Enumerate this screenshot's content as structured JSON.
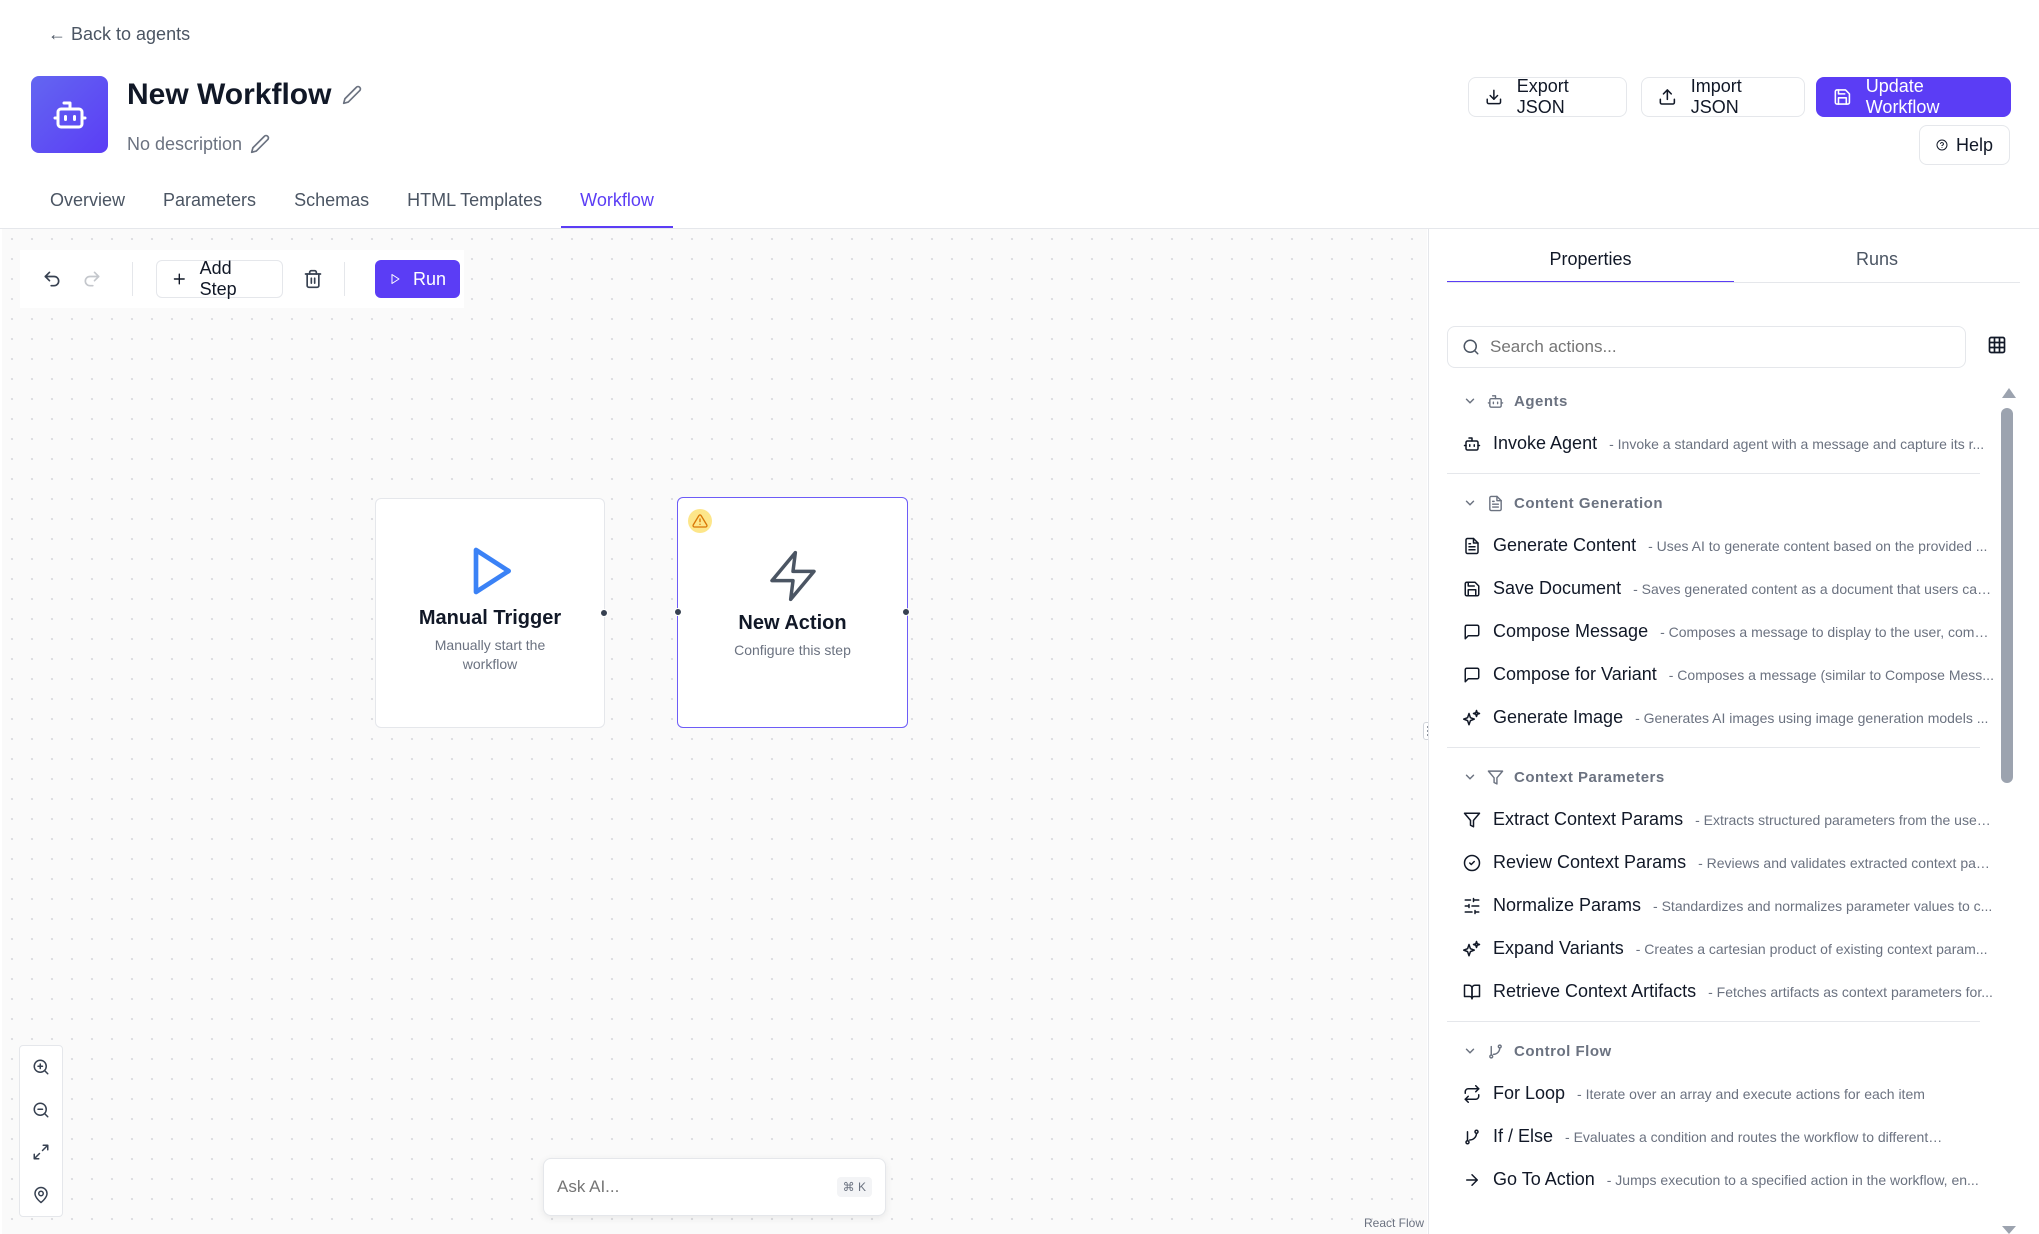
{
  "header": {
    "back_link": "← Back to agents",
    "title": "New Workflow",
    "description": "No description",
    "buttons": {
      "export": "Export JSON",
      "import": "Import JSON",
      "update": "Update Workflow",
      "help": "Help"
    }
  },
  "tabs": [
    {
      "label": "Overview",
      "active": false
    },
    {
      "label": "Parameters",
      "active": false
    },
    {
      "label": "Schemas",
      "active": false
    },
    {
      "label": "HTML Templates",
      "active": false
    },
    {
      "label": "Workflow",
      "active": true
    }
  ],
  "toolbar": {
    "add_step": "Add Step",
    "run": "Run"
  },
  "nodes": {
    "trigger": {
      "title": "Manual Trigger",
      "subtitle": "Manually start the workflow"
    },
    "action": {
      "title": "New Action",
      "subtitle": "Configure this step"
    }
  },
  "ask_ai": {
    "placeholder": "Ask AI...",
    "shortcut": "⌘ K"
  },
  "attribution": "React Flow",
  "panel": {
    "tabs": [
      "Properties",
      "Runs"
    ],
    "active_tab": "Properties",
    "search_placeholder": "Search actions...",
    "categories": [
      {
        "name": "Agents",
        "icon": "bot-icon",
        "items": [
          {
            "name": "Invoke Agent",
            "desc": "- Invoke a standard agent with a message and capture its r...",
            "icon": "bot-icon"
          }
        ]
      },
      {
        "name": "Content Generation",
        "icon": "document-icon",
        "items": [
          {
            "name": "Generate Content",
            "desc": "- Uses AI to generate content based on the provided ...",
            "icon": "document-icon"
          },
          {
            "name": "Save Document",
            "desc": "- Saves generated content as a document that users can...",
            "icon": "save-icon"
          },
          {
            "name": "Compose Message",
            "desc": "- Composes a message to display to the user, combi...",
            "icon": "message-icon"
          },
          {
            "name": "Compose for Variant",
            "desc": "- Composes a message (similar to Compose Mess...",
            "icon": "message-icon"
          },
          {
            "name": "Generate Image",
            "desc": "- Generates AI images using image generation models ...",
            "icon": "sparkles-icon"
          }
        ]
      },
      {
        "name": "Context Parameters",
        "icon": "filter-icon",
        "items": [
          {
            "name": "Extract Context Params",
            "desc": "- Extracts structured parameters from the user ...",
            "icon": "filter-icon"
          },
          {
            "name": "Review Context Params",
            "desc": "- Reviews and validates extracted context para...",
            "icon": "check-circle-icon"
          },
          {
            "name": "Normalize Params",
            "desc": "- Standardizes and normalizes parameter values to c...",
            "icon": "sliders-icon"
          },
          {
            "name": "Expand Variants",
            "desc": "- Creates a cartesian product of existing context param...",
            "icon": "sparkles-icon"
          },
          {
            "name": "Retrieve Context Artifacts",
            "desc": "- Fetches artifacts as context parameters for...",
            "icon": "book-icon"
          }
        ]
      },
      {
        "name": "Control Flow",
        "icon": "branch-icon",
        "items": [
          {
            "name": "For Loop",
            "desc": "- Iterate over an array and execute actions for each item",
            "icon": "repeat-icon"
          },
          {
            "name": "If / Else",
            "desc": "- Evaluates a condition and routes the workflow to different branc...",
            "icon": "branch-icon"
          },
          {
            "name": "Go To Action",
            "desc": "- Jumps execution to a specified action in the workflow, en...",
            "icon": "arrow-right-icon"
          }
        ]
      }
    ]
  }
}
